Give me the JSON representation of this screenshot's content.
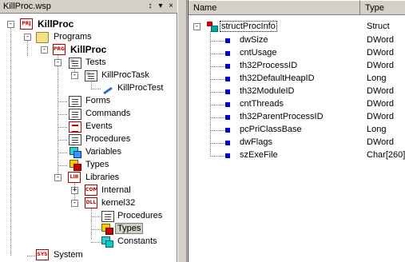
{
  "workspace": {
    "title": "KillProc.wsp",
    "pin_glyph": "↕",
    "dropdown_glyph": "▾",
    "close_glyph": "×"
  },
  "tree": {
    "root": {
      "label": "KillProc",
      "icon": "prj-icon",
      "icon_text": "PRJ"
    },
    "programs": {
      "label": "Programs",
      "icon": "folder-icon"
    },
    "killproc_program": {
      "label": "KillProc",
      "icon": "prg-icon",
      "icon_text": "PRG"
    },
    "tests": {
      "label": "Tests",
      "icon": "tests-icon"
    },
    "killproctask": {
      "label": "KillProcTask",
      "icon": "test-task-icon"
    },
    "killproctest": {
      "label": "KillProcTest",
      "icon": "test-case-icon"
    },
    "forms": {
      "label": "Forms",
      "icon": "forms-icon"
    },
    "commands": {
      "label": "Commands",
      "icon": "commands-icon"
    },
    "events": {
      "label": "Events",
      "icon": "events-icon"
    },
    "procedures": {
      "label": "Procedures",
      "icon": "procedures-icon"
    },
    "variables": {
      "label": "Variables",
      "icon": "variables-icon"
    },
    "types": {
      "label": "Types",
      "icon": "types-icon"
    },
    "libraries": {
      "label": "Libraries",
      "icon": "lib-icon",
      "icon_text": "LIB"
    },
    "internal": {
      "label": "Internal",
      "icon": "com-icon",
      "icon_text": "COM"
    },
    "kernel32": {
      "label": "kernel32",
      "icon": "dll-icon",
      "icon_text": "DLL"
    },
    "k32_procedures": {
      "label": "Procedures",
      "icon": "procedures-icon"
    },
    "k32_types": {
      "label": "Types",
      "icon": "types-icon"
    },
    "k32_constants": {
      "label": "Constants",
      "icon": "constants-icon"
    },
    "system": {
      "label": "System",
      "icon": "sys-icon",
      "icon_text": "SYS"
    },
    "expander_minus": "-",
    "expander_plus": "+"
  },
  "list": {
    "columns": {
      "name": "Name",
      "type": "Type"
    },
    "struct": {
      "name": "structProcInfo",
      "type": "Struct"
    },
    "fields": [
      {
        "name": "dwSize",
        "type": "DWord"
      },
      {
        "name": "cntUsage",
        "type": "DWord"
      },
      {
        "name": "th32ProcessID",
        "type": "DWord"
      },
      {
        "name": "th32DefaultHeapID",
        "type": "Long"
      },
      {
        "name": "th32ModuleID",
        "type": "DWord"
      },
      {
        "name": "cntThreads",
        "type": "DWord"
      },
      {
        "name": "th32ParentProcessID",
        "type": "DWord"
      },
      {
        "name": "pcPriClassBase",
        "type": "Long"
      },
      {
        "name": "dwFlags",
        "type": "DWord"
      },
      {
        "name": "szExeFile",
        "type": "Char[260]"
      }
    ]
  },
  "colors": {
    "selection_bg": "#d4d0c8",
    "field_marker": "#0000cc",
    "panel": "#d4d0c8"
  }
}
